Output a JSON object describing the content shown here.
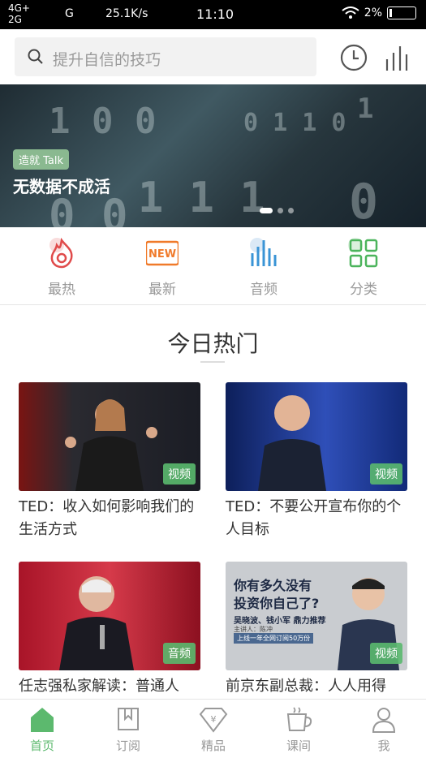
{
  "status_bar": {
    "signal_top": "4G+",
    "signal_bottom": "2G",
    "network": "G",
    "speed": "25.1K/s",
    "time": "11:10",
    "battery": "2%"
  },
  "search": {
    "placeholder": "提升自信的技巧"
  },
  "header_icons": [
    "clock-icon",
    "bars-icon"
  ],
  "banner": {
    "tag": "造就 Talk",
    "title": "无数据不成活",
    "page_count": 3,
    "active_page": 1
  },
  "quick_nav": [
    {
      "label": "最热",
      "icon": "flame-icon",
      "color": "#e04b4b"
    },
    {
      "label": "最新",
      "icon": "new-icon",
      "color": "#f07a2a"
    },
    {
      "label": "音频",
      "icon": "audio-bars-icon",
      "color": "#3a94d6"
    },
    {
      "label": "分类",
      "icon": "grid-icon",
      "color": "#4cb45c"
    }
  ],
  "section": {
    "title": "今日热门"
  },
  "cards": [
    {
      "title": "TED：收入如何影响我们的生活方式",
      "badge": "视频"
    },
    {
      "title": "TED：不要公开宣布你的个人目标",
      "badge": "视频"
    },
    {
      "title": "任志强私家解读：普通人",
      "badge": "音频"
    },
    {
      "title": "前京东副总裁：人人用得",
      "badge": "视频",
      "poster": {
        "line1": "你有多久没有",
        "line2": "投资你自己了?",
        "line3": "吴晓波、钱小军 鼎力推荐",
        "line4": "主讲人：陈冲",
        "line5": "上线一年全网订阅50万份"
      }
    }
  ],
  "tab_bar": [
    {
      "label": "首页",
      "icon": "home-icon",
      "active": true
    },
    {
      "label": "订阅",
      "icon": "bookmark-icon",
      "active": false
    },
    {
      "label": "精品",
      "icon": "yen-diamond-icon",
      "active": false
    },
    {
      "label": "课间",
      "icon": "cup-icon",
      "active": false
    },
    {
      "label": "我",
      "icon": "user-icon",
      "active": false
    }
  ],
  "colors": {
    "accent": "#5cb96e",
    "text": "#333333",
    "muted": "#999999"
  }
}
